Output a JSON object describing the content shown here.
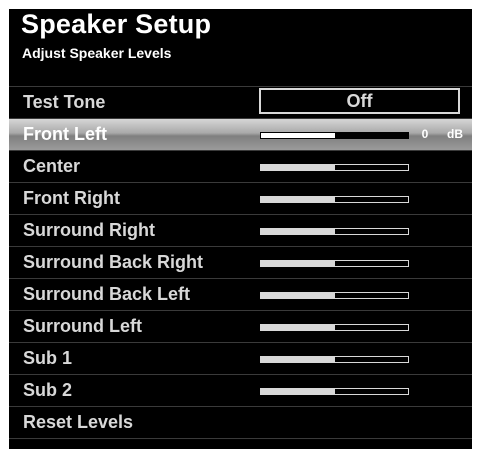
{
  "title": "Speaker Setup",
  "subtitle": "Adjust Speaker Levels",
  "test_tone": {
    "label": "Test Tone",
    "value": "Off"
  },
  "levels": [
    {
      "label": "Front Left",
      "value": "0",
      "unit": "dB",
      "level": 0.5,
      "selected": true
    },
    {
      "label": "Center",
      "level": 0.5
    },
    {
      "label": "Front Right",
      "level": 0.5
    },
    {
      "label": "Surround Right",
      "level": 0.5
    },
    {
      "label": "Surround Back Right",
      "level": 0.5
    },
    {
      "label": "Surround Back Left",
      "level": 0.5
    },
    {
      "label": "Surround Left",
      "level": 0.5
    },
    {
      "label": "Sub 1",
      "level": 0.5
    },
    {
      "label": "Sub 2",
      "level": 0.5
    }
  ],
  "reset_label": "Reset Levels",
  "colors": {
    "background": "#000000",
    "text": "#d8d8d8",
    "highlight": "#a9a9a9"
  }
}
